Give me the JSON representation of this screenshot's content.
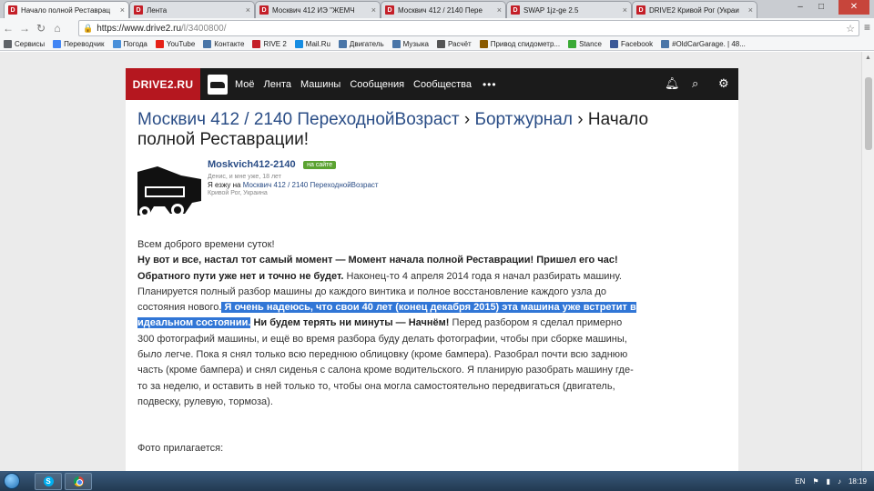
{
  "browser": {
    "tabs": [
      {
        "title": "Начало полной Реставрац",
        "active": true
      },
      {
        "title": "Лента",
        "active": false
      },
      {
        "title": "Москвич 412 ИЭ \"ЖЕМЧ",
        "active": false
      },
      {
        "title": "Москвич 412 / 2140 Пере",
        "active": false
      },
      {
        "title": "SWAP 1jz-ge 2.5",
        "active": false
      },
      {
        "title": "DRIVE2 Кривой Рог (Украи",
        "active": false
      }
    ],
    "favicon_letter": "D",
    "tab_close": "×",
    "url_host": "https://www.drive2.ru",
    "url_path": "/l/3400800/",
    "bookmarks": [
      {
        "label": "Сервисы",
        "color": "#5f6368"
      },
      {
        "label": "Переводчик",
        "color": "#4285f4"
      },
      {
        "label": "Погода",
        "color": "#4a90d9"
      },
      {
        "label": "YouTube",
        "color": "#e62117"
      },
      {
        "label": "Контакте",
        "color": "#4a76a8"
      },
      {
        "label": "RIVE 2",
        "color": "#c41f28"
      },
      {
        "label": "Mail.Ru",
        "color": "#168de2"
      },
      {
        "label": "Двигатель",
        "color": "#4a76a8"
      },
      {
        "label": "Музыка",
        "color": "#4a76a8"
      },
      {
        "label": "Расчёт",
        "color": "#555555"
      },
      {
        "label": "Привод спидометр...",
        "color": "#8a5a00"
      },
      {
        "label": "Stance",
        "color": "#3aaa35"
      },
      {
        "label": "Facebook",
        "color": "#3b5998"
      },
      {
        "label": "#OldCarGarage. | 48...",
        "color": "#4a76a8"
      }
    ]
  },
  "site": {
    "logo": "DRIVE2.RU",
    "nav": [
      "Моё",
      "Лента",
      "Машины",
      "Сообщения",
      "Сообщества"
    ],
    "nav_more": "•••"
  },
  "article": {
    "title_link1": "Москвич 412 / 2140 ПереходнойВозраст",
    "sep1": " › ",
    "title_link2": "Бортжурнал",
    "sep2": " › ",
    "title_rest": "Начало полной Реставрации!",
    "author": {
      "name": "Moskvich412-2140",
      "badge": "на сайте",
      "meta": "Денис, и мне уже, 18 лет",
      "drive_prefix": "Я езжу на ",
      "car": "Москвич 412 / 2140 ПереходнойВозраст",
      "city": "Кривой Рог, Украина"
    },
    "greeting": "Всем доброго времени суток!",
    "bold1": "Ну вот и все, настал тот самый момент — Момент начала полной Реставрации! Пришел его час! Обратного пути уже нет и точно не будет.",
    "normal1": " Наконец-то 4 апреля 2014 года я начал разбирать машину. Планируется полный разбор машины до каждого винтика и полное восстановление каждого узла до состояния нового.",
    "highlight": " Я очень надеюсь, что свои 40 лет (конец декабря 2015) эта машина уже встретит в идеальном состоянии.",
    "bold2": " Ни будем терять ни минуты — Начнём!",
    "normal2": " Перед разбором я сделал примерно 300 фотографий машины, и ещё во время разбора буду делать фотографии, чтобы при сборке машины, было легче. Пока я снял только всю переднюю облицовку (кроме бампера). Разобрал почти всю заднюю часть (кроме бампера) и снял сиденья с салона кроме водительского. Я планирую разобрать машину где-то за неделю, и оставить в ней только то, чтобы она могла самостоятельно передвигаться (двигатель, подвеску, рулевую, тормоза).",
    "foto": "Фото прилагается:"
  },
  "taskbar": {
    "lang": "EN",
    "time": "18:19"
  }
}
